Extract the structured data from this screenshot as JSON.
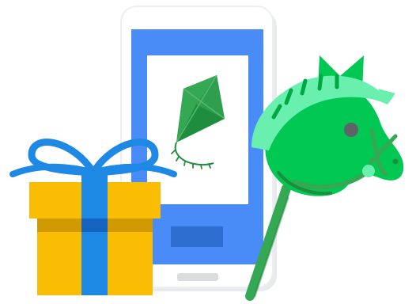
{
  "illustration": {
    "items": [
      "phone-icon",
      "kite-icon",
      "gift-box-icon",
      "hobby-horse-icon"
    ]
  },
  "colors": {
    "phone_body": "#ffffff",
    "phone_screen": "#4a8cf7",
    "phone_button": "#2f6ed1",
    "phone_home_bar": "#dadce0",
    "kite_dark": "#1e8e3e",
    "kite_light": "#34a853",
    "gift_box": "#fbbc04",
    "gift_band": "#d19a00",
    "gift_ribbon": "#1e88e5",
    "horse_head": "#00c853",
    "horse_mane": "#69f0ae",
    "horse_stick": "#34a853",
    "horse_eye": "#5f6368"
  }
}
